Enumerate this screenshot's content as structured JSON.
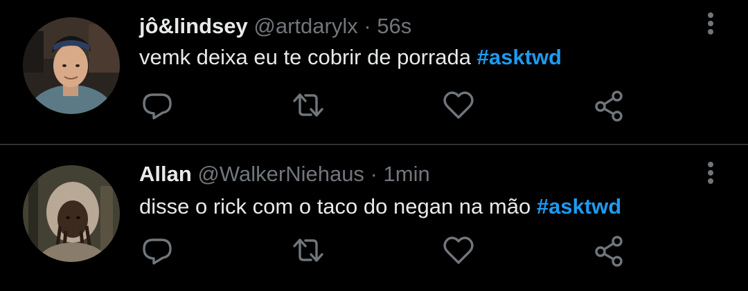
{
  "colors": {
    "background": "#000000",
    "primary_text": "#e7e9ea",
    "secondary_text": "#71767b",
    "hashtag": "#1d9bf0",
    "divider": "#2f3336"
  },
  "tweets": [
    {
      "display_name": "jô&lindsey",
      "handle": "@artdarylx",
      "separator": "·",
      "time": "56s",
      "text": "vemk deixa eu te cobrir de porrada ",
      "hashtag": "#asktwd",
      "actions": [
        "reply-icon",
        "retweet-icon",
        "like-icon",
        "share-icon"
      ],
      "more_icon": "more-vertical-icon"
    },
    {
      "display_name": "Allan",
      "handle": "@WalkerNiehaus",
      "separator": "·",
      "time": "1min",
      "text": "disse o rick com o taco do negan na mão ",
      "hashtag": "#asktwd",
      "actions": [
        "reply-icon",
        "retweet-icon",
        "like-icon",
        "share-icon"
      ],
      "more_icon": "more-vertical-icon"
    }
  ]
}
